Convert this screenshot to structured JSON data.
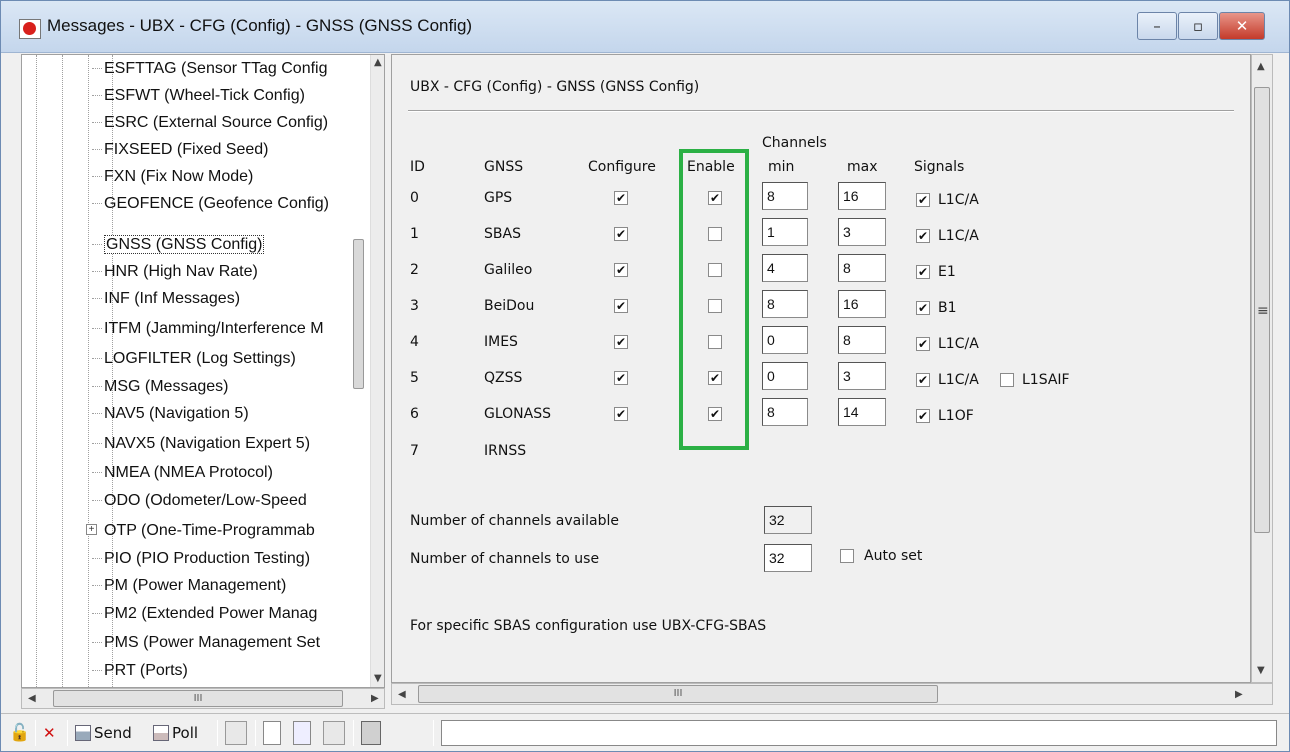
{
  "window": {
    "title": "Messages - UBX - CFG (Config) - GNSS (GNSS Config)",
    "min": "–",
    "max": "▫",
    "close": "✕"
  },
  "tree": {
    "items": [
      {
        "label": "ESFTTAG (Sensor TTag Config"
      },
      {
        "label": "ESFWT (Wheel-Tick Config)"
      },
      {
        "label": "ESRC (External Source Config)"
      },
      {
        "label": "FIXSEED (Fixed Seed)"
      },
      {
        "label": "FXN (Fix Now Mode)"
      },
      {
        "label": "GEOFENCE (Geofence Config)"
      },
      {
        "label": "GNSS (GNSS Config)"
      },
      {
        "label": "HNR (High Nav Rate)"
      },
      {
        "label": "INF (Inf Messages)"
      },
      {
        "label": "ITFM (Jamming/Interference M"
      },
      {
        "label": "LOGFILTER (Log Settings)"
      },
      {
        "label": "MSG (Messages)"
      },
      {
        "label": "NAV5 (Navigation 5)"
      },
      {
        "label": "NAVX5 (Navigation Expert 5)"
      },
      {
        "label": "NMEA (NMEA Protocol)"
      },
      {
        "label": "ODO (Odometer/Low-Speed"
      },
      {
        "label": "OTP (One-Time-Programmab"
      },
      {
        "label": "PIO (PIO Production Testing)"
      },
      {
        "label": "PM (Power Management)"
      },
      {
        "label": "PM2 (Extended Power Manag"
      },
      {
        "label": "PMS (Power Management Set"
      },
      {
        "label": "PRT (Ports)"
      }
    ],
    "selected": "GNSS (GNSS Config)"
  },
  "form": {
    "title": "UBX - CFG (Config) - GNSS (GNSS Config)",
    "headers": {
      "channels": "Channels",
      "id": "ID",
      "gnss": "GNSS",
      "configure": "Configure",
      "enable": "Enable",
      "min": "min",
      "max": "max",
      "signals": "Signals"
    },
    "rows": [
      {
        "id": "0",
        "gnss": "GPS",
        "min": "8",
        "max": "16",
        "signal": "L1C/A"
      },
      {
        "id": "1",
        "gnss": "SBAS",
        "min": "1",
        "max": "3",
        "signal": "L1C/A"
      },
      {
        "id": "2",
        "gnss": "Galileo",
        "min": "4",
        "max": "8",
        "signal": "E1"
      },
      {
        "id": "3",
        "gnss": "BeiDou",
        "min": "8",
        "max": "16",
        "signal": "B1"
      },
      {
        "id": "4",
        "gnss": "IMES",
        "min": "0",
        "max": "8",
        "signal": "L1C/A"
      },
      {
        "id": "5",
        "gnss": "QZSS",
        "min": "0",
        "max": "3",
        "signal": "L1C/A",
        "signal2": "L1SAIF"
      },
      {
        "id": "6",
        "gnss": "GLONASS",
        "min": "8",
        "max": "14",
        "signal": "L1OF"
      },
      {
        "id": "7",
        "gnss": "IRNSS"
      }
    ],
    "channels_available_label": "Number of channels available",
    "channels_available": "32",
    "channels_use_label": "Number of channels to use",
    "channels_use": "32",
    "auto_set_label": "Auto set",
    "sbas_note": "For specific SBAS configuration use UBX-CFG-SBAS"
  },
  "toolbar": {
    "send": "Send",
    "poll": "Poll"
  },
  "scrollbar": {
    "grip": "III",
    "vgrip": "≡"
  },
  "check_mark": "✔",
  "colors": {
    "highlight": "#2bb045"
  }
}
